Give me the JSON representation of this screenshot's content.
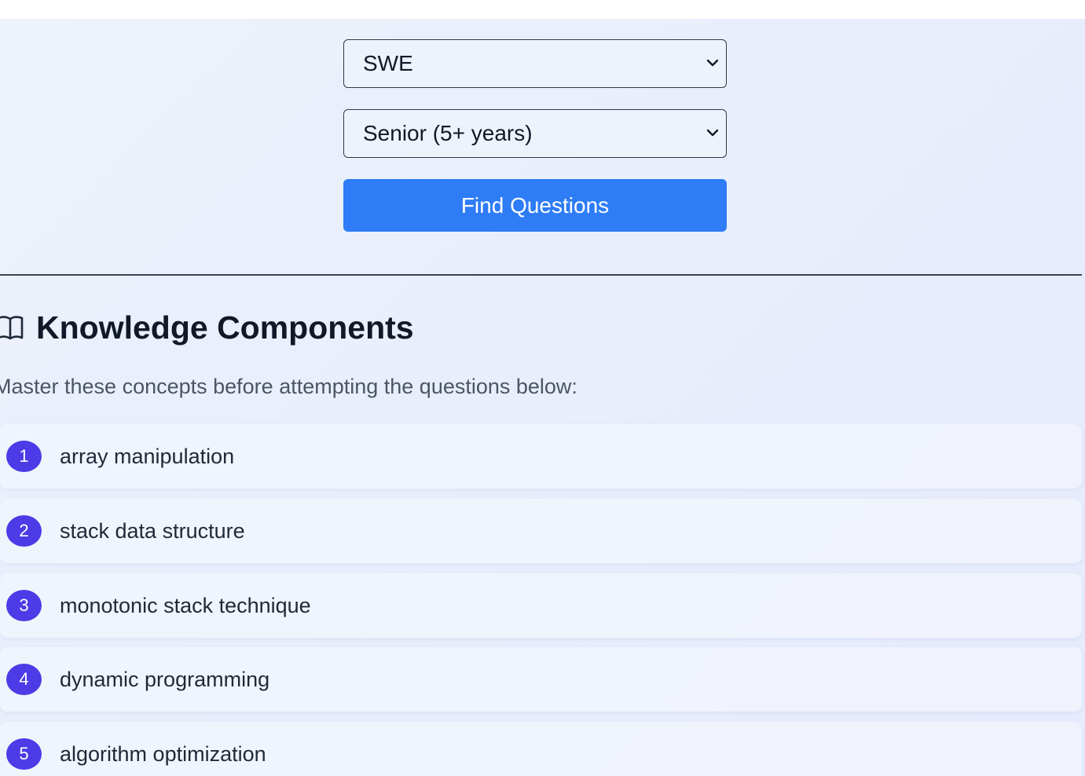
{
  "form": {
    "role_select": {
      "value": "SWE"
    },
    "level_select": {
      "value": "Senior (5+ years)"
    },
    "find_button_label": "Find Questions"
  },
  "knowledge": {
    "title": "Knowledge Components",
    "subtitle": "Master these concepts before attempting the questions below:",
    "items": [
      {
        "number": "1",
        "label": "array manipulation"
      },
      {
        "number": "2",
        "label": "stack data structure"
      },
      {
        "number": "3",
        "label": "monotonic stack technique"
      },
      {
        "number": "4",
        "label": "dynamic programming"
      },
      {
        "number": "5",
        "label": "algorithm optimization"
      }
    ]
  },
  "colors": {
    "accent": "#2e7cf6",
    "badge": "#4c3be6",
    "heading": "#111827"
  },
  "icons": {
    "select_chevron": "chevron-down-icon",
    "section_icon": "book-icon"
  }
}
